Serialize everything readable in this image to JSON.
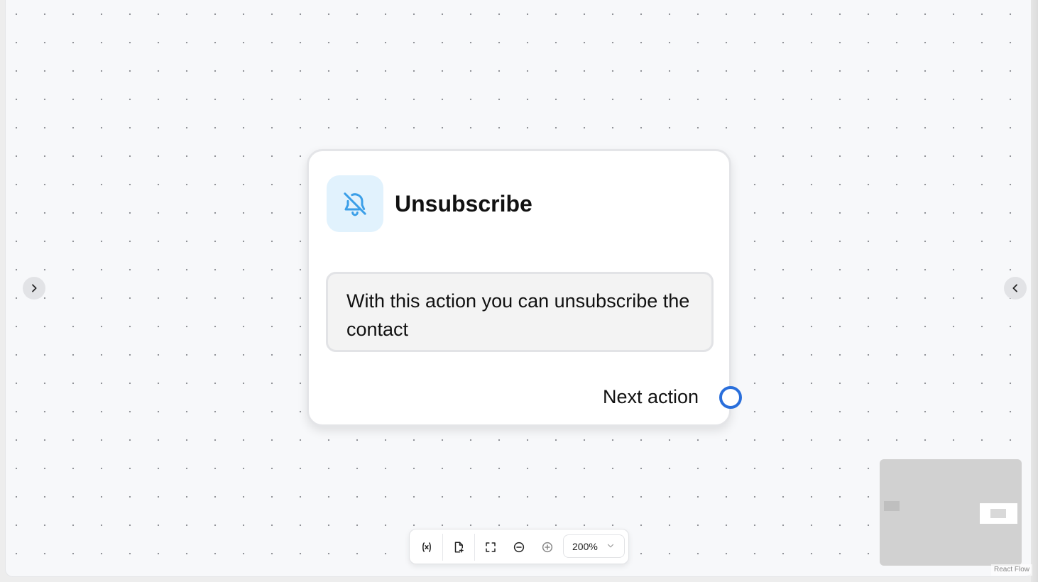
{
  "node": {
    "icon": "bell-off-icon",
    "title": "Unsubscribe",
    "description": "With this action you can unsubscribe the contact",
    "output_label": "Next action"
  },
  "panels": {
    "left_toggle_icon": "chevron-right-icon",
    "right_toggle_icon": "chevron-left-icon"
  },
  "toolbar": {
    "variables_icon": "variable-icon",
    "add_file_icon": "file-plus-icon",
    "fit_view_icon": "fullscreen-icon",
    "zoom_out_icon": "zoom-out-icon",
    "zoom_in_icon": "zoom-in-icon",
    "zoom_level": "200%"
  },
  "attribution": "React Flow",
  "colors": {
    "canvas_bg": "#f7f8fa",
    "icon_tint": "#3b9fe8",
    "icon_bg": "#e1f2fd",
    "handle": "#2a6fdb",
    "minimap_bg": "#d1d1d1"
  }
}
